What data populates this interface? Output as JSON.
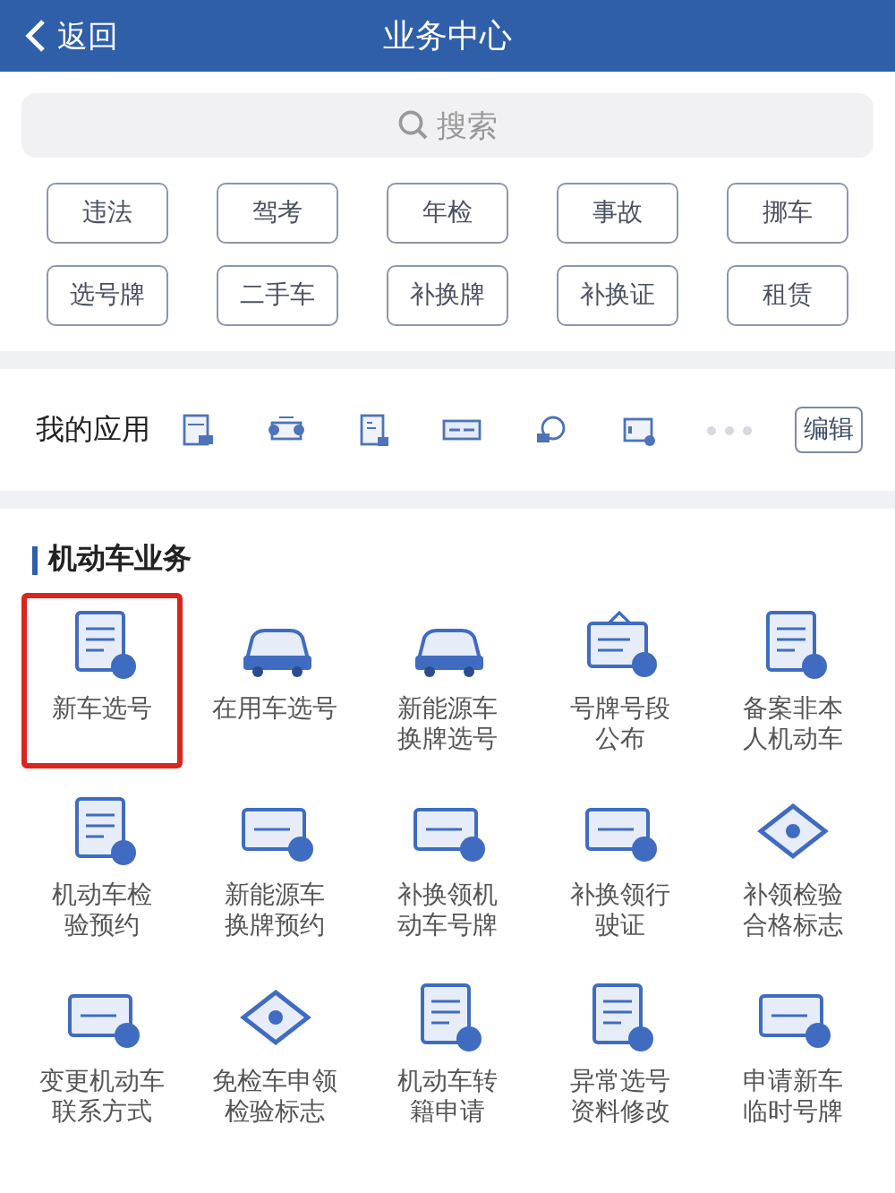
{
  "header": {
    "back": "返回",
    "title": "业务中心"
  },
  "search": {
    "placeholder": "搜索"
  },
  "quick_links": [
    "违法",
    "驾考",
    "年检",
    "事故",
    "挪车",
    "选号牌",
    "二手车",
    "补换牌",
    "补换证",
    "租赁"
  ],
  "my_apps": {
    "title": "我的应用",
    "edit": "编辑"
  },
  "section": {
    "title": "机动车业务",
    "items": [
      {
        "lines": [
          "新车选号"
        ],
        "selected": true
      },
      {
        "lines": [
          "在用车选号"
        ],
        "selected": false
      },
      {
        "lines": [
          "新能源车",
          "换牌选号"
        ],
        "selected": false
      },
      {
        "lines": [
          "号牌号段",
          "公布"
        ],
        "selected": false
      },
      {
        "lines": [
          "备案非本",
          "人机动车"
        ],
        "selected": false
      },
      {
        "lines": [
          "机动车检",
          "验预约"
        ],
        "selected": false
      },
      {
        "lines": [
          "新能源车",
          "换牌预约"
        ],
        "selected": false
      },
      {
        "lines": [
          "补换领机",
          "动车号牌"
        ],
        "selected": false
      },
      {
        "lines": [
          "补换领行",
          "驶证"
        ],
        "selected": false
      },
      {
        "lines": [
          "补领检验",
          "合格标志"
        ],
        "selected": false
      },
      {
        "lines": [
          "变更机动车",
          "联系方式"
        ],
        "selected": false
      },
      {
        "lines": [
          "免检车申领",
          "检验标志"
        ],
        "selected": false
      },
      {
        "lines": [
          "机动车转",
          "籍申请"
        ],
        "selected": false
      },
      {
        "lines": [
          "异常选号",
          "资料修改"
        ],
        "selected": false
      },
      {
        "lines": [
          "申请新车",
          "临时号牌"
        ],
        "selected": false
      }
    ]
  }
}
